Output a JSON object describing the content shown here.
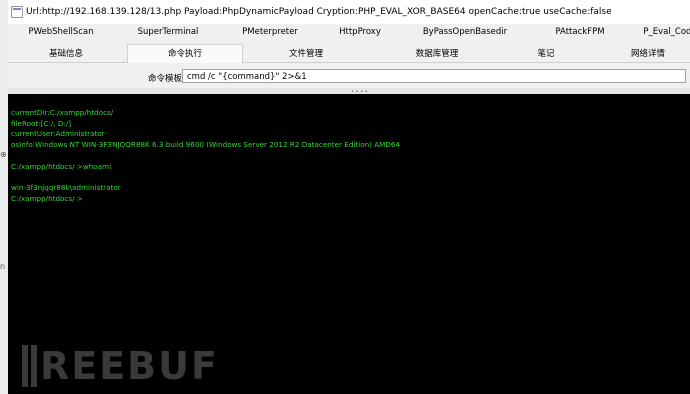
{
  "window": {
    "title": "Url:http://192.168.139.128/13.php Payload:PhpDynamicPayload Cryption:PHP_EVAL_XOR_BASE64 openCache:true useCache:false"
  },
  "plugins_row": [
    "PWebShellScan",
    "SuperTerminal",
    "PMeterpreter",
    "HttpProxy",
    "ByPassOpenBasedir",
    "PAttackFPM",
    "P_Eval_Code"
  ],
  "main_tabs": [
    "基础信息",
    "命令执行",
    "文件管理",
    "数据库管理",
    "笔记",
    "网络详情"
  ],
  "active_tab": "命令执行",
  "command_template": {
    "label": "命令模板",
    "value": "cmd /c \"{command}\" 2>&1"
  },
  "terminal": {
    "lines": [
      "currentDir:C:/xampp/htdocs/",
      "fileRoot:[C:/, D:/]",
      "currentUser:Administrator",
      "osInfo:Windows NT WIN-3F3NJQQR88K 6.3 build 9600 (Windows Server 2012 R2 Datacenter Edition) AMD64",
      "",
      "C:/xampp/htdocs/ >whoami",
      "",
      "win-3f3njqqr88k\\administrator",
      "C:/xampp/htdocs/ >"
    ]
  },
  "watermark": {
    "text": "REEBUF"
  },
  "colors": {
    "terminal_bg": "#000000",
    "terminal_text": "#36d436",
    "chrome_bg": "#f0f0f0"
  }
}
